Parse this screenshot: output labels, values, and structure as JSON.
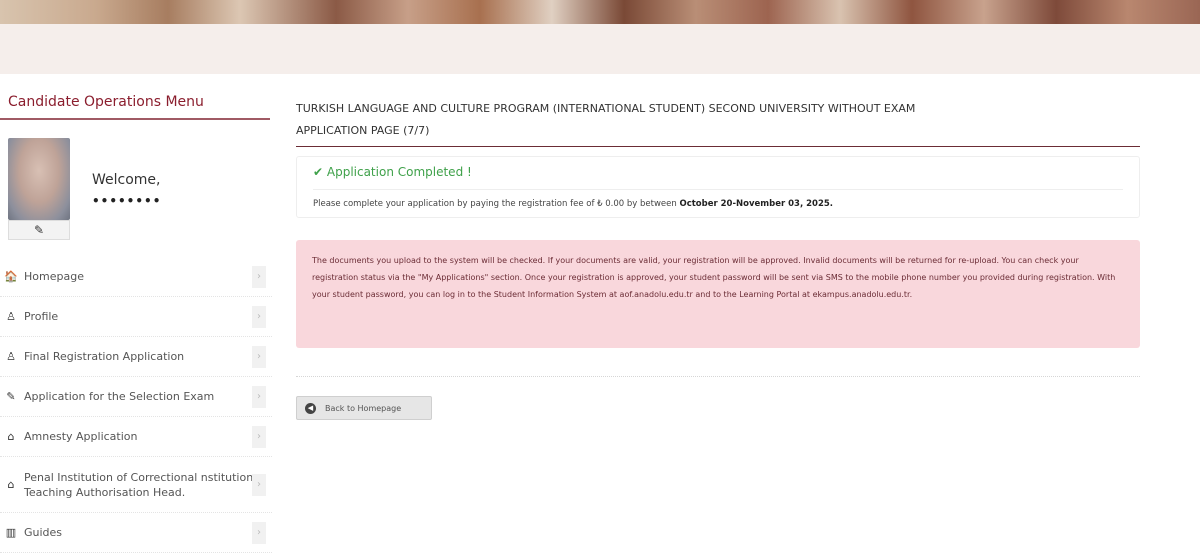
{
  "sidebar": {
    "menu_title": "Candidate Operations Menu",
    "welcome": "Welcome,",
    "user_name": "••••••••",
    "edit_icon": "pencil-icon",
    "items": [
      {
        "icon": "home-icon",
        "glyph": "🏠",
        "label": "Homepage"
      },
      {
        "icon": "user-icon",
        "glyph": "♙",
        "label": "Profile"
      },
      {
        "icon": "user-edit-icon",
        "glyph": "♙",
        "label": "Final Registration Application"
      },
      {
        "icon": "exam-icon",
        "glyph": "✎",
        "label": "Application for the Selection Exam"
      },
      {
        "icon": "institution-icon",
        "glyph": "⌂",
        "label": "Amnesty Application"
      },
      {
        "icon": "building-icon",
        "glyph": "⌂",
        "label": "Penal Institution of Correctional nstitution Teaching Authorisation Head."
      },
      {
        "icon": "book-icon",
        "glyph": "▥",
        "label": "Guides"
      }
    ],
    "chevron_icon": "chevron-right-icon"
  },
  "main": {
    "title_line1": "TURKISH LANGUAGE AND CULTURE PROGRAM (INTERNATIONAL STUDENT) SECOND UNIVERSITY WITHOUT EXAM",
    "title_line2": "APPLICATION PAGE (7/7)",
    "success_title": "✔ Application Completed !",
    "fee_text": "Please complete your application by paying the registration fee of ₺ 0.00 by between ",
    "fee_dates": "October 20-November 03, 2025.",
    "info_text": "The documents you upload to the system will be checked. If your documents are valid, your registration will be approved. Invalid documents will be returned for re-upload. You can check your registration status via the \"My Applications\" section. Once your registration is approved, your student password will be sent via SMS to the mobile phone number you provided during registration. With your student password, you can log in to the Student Information System at aof.anadolu.edu.tr and to the Learning Portal at ekampus.anadolu.edu.tr.",
    "back_label": "Back to Homepage",
    "back_icon": "arrow-left-circle-icon"
  },
  "colors": {
    "accent": "#8b1e2e",
    "success": "#3fa14a",
    "info_bg": "#f9d7dc",
    "info_text": "#6b2c35"
  }
}
